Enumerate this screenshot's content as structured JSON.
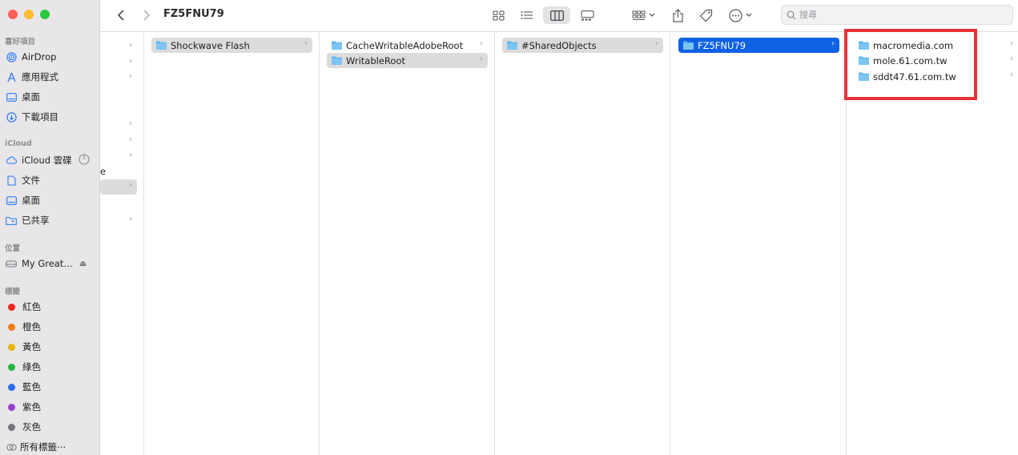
{
  "window": {
    "title": "FZ5FNU79",
    "search": {
      "placeholder": "搜尋",
      "value": ""
    }
  },
  "sidebar": {
    "favorites_header": "喜好項目",
    "favorites": [
      {
        "label": "AirDrop",
        "icon": "airdrop-icon"
      },
      {
        "label": "應用程式",
        "icon": "applications-icon"
      },
      {
        "label": "桌面",
        "icon": "desktop-icon"
      },
      {
        "label": "下載項目",
        "icon": "downloads-icon"
      }
    ],
    "icloud_header": "iCloud",
    "icloud": [
      {
        "label": "iCloud 雲碟",
        "icon": "icloud-drive-icon"
      },
      {
        "label": "文件",
        "icon": "document-icon"
      },
      {
        "label": "桌面",
        "icon": "desktop-icon"
      },
      {
        "label": "已共享",
        "icon": "shared-folder-icon"
      }
    ],
    "locations_header": "位置",
    "locations": [
      {
        "label": "My Great…",
        "icon": "disk-icon"
      }
    ],
    "tags_header": "標籤",
    "tags": [
      {
        "label": "紅色",
        "color": "#f0231f"
      },
      {
        "label": "橙色",
        "color": "#f07a15"
      },
      {
        "label": "黃色",
        "color": "#e9b410"
      },
      {
        "label": "綠色",
        "color": "#21b73b"
      },
      {
        "label": "藍色",
        "color": "#2a6cf0"
      },
      {
        "label": "紫色",
        "color": "#9b3ed0"
      },
      {
        "label": "灰色",
        "color": "#76767a"
      },
      {
        "label": "所有標籤⋯",
        "color": ""
      }
    ]
  },
  "columns": {
    "col0_partial_text": "e",
    "col1": [
      {
        "label": "Shockwave Flash",
        "state": "selected-inactive"
      }
    ],
    "col2": [
      {
        "label": "CacheWritableAdobeRoot",
        "state": "normal"
      },
      {
        "label": "WritableRoot",
        "state": "selected-inactive"
      }
    ],
    "col3": [
      {
        "label": "#SharedObjects",
        "state": "selected-inactive"
      }
    ],
    "col4": [
      {
        "label": "FZ5FNU79",
        "state": "selected-active"
      }
    ],
    "col5": [
      {
        "label": "macromedia.com",
        "state": "normal"
      },
      {
        "label": "mole.61.com.tw",
        "state": "normal"
      },
      {
        "label": "sddt47.61.com.tw",
        "state": "normal"
      }
    ]
  },
  "colors": {
    "accent": "#1062e5",
    "highlight_box": "#e5323a",
    "folder": "#5eb4ef"
  }
}
